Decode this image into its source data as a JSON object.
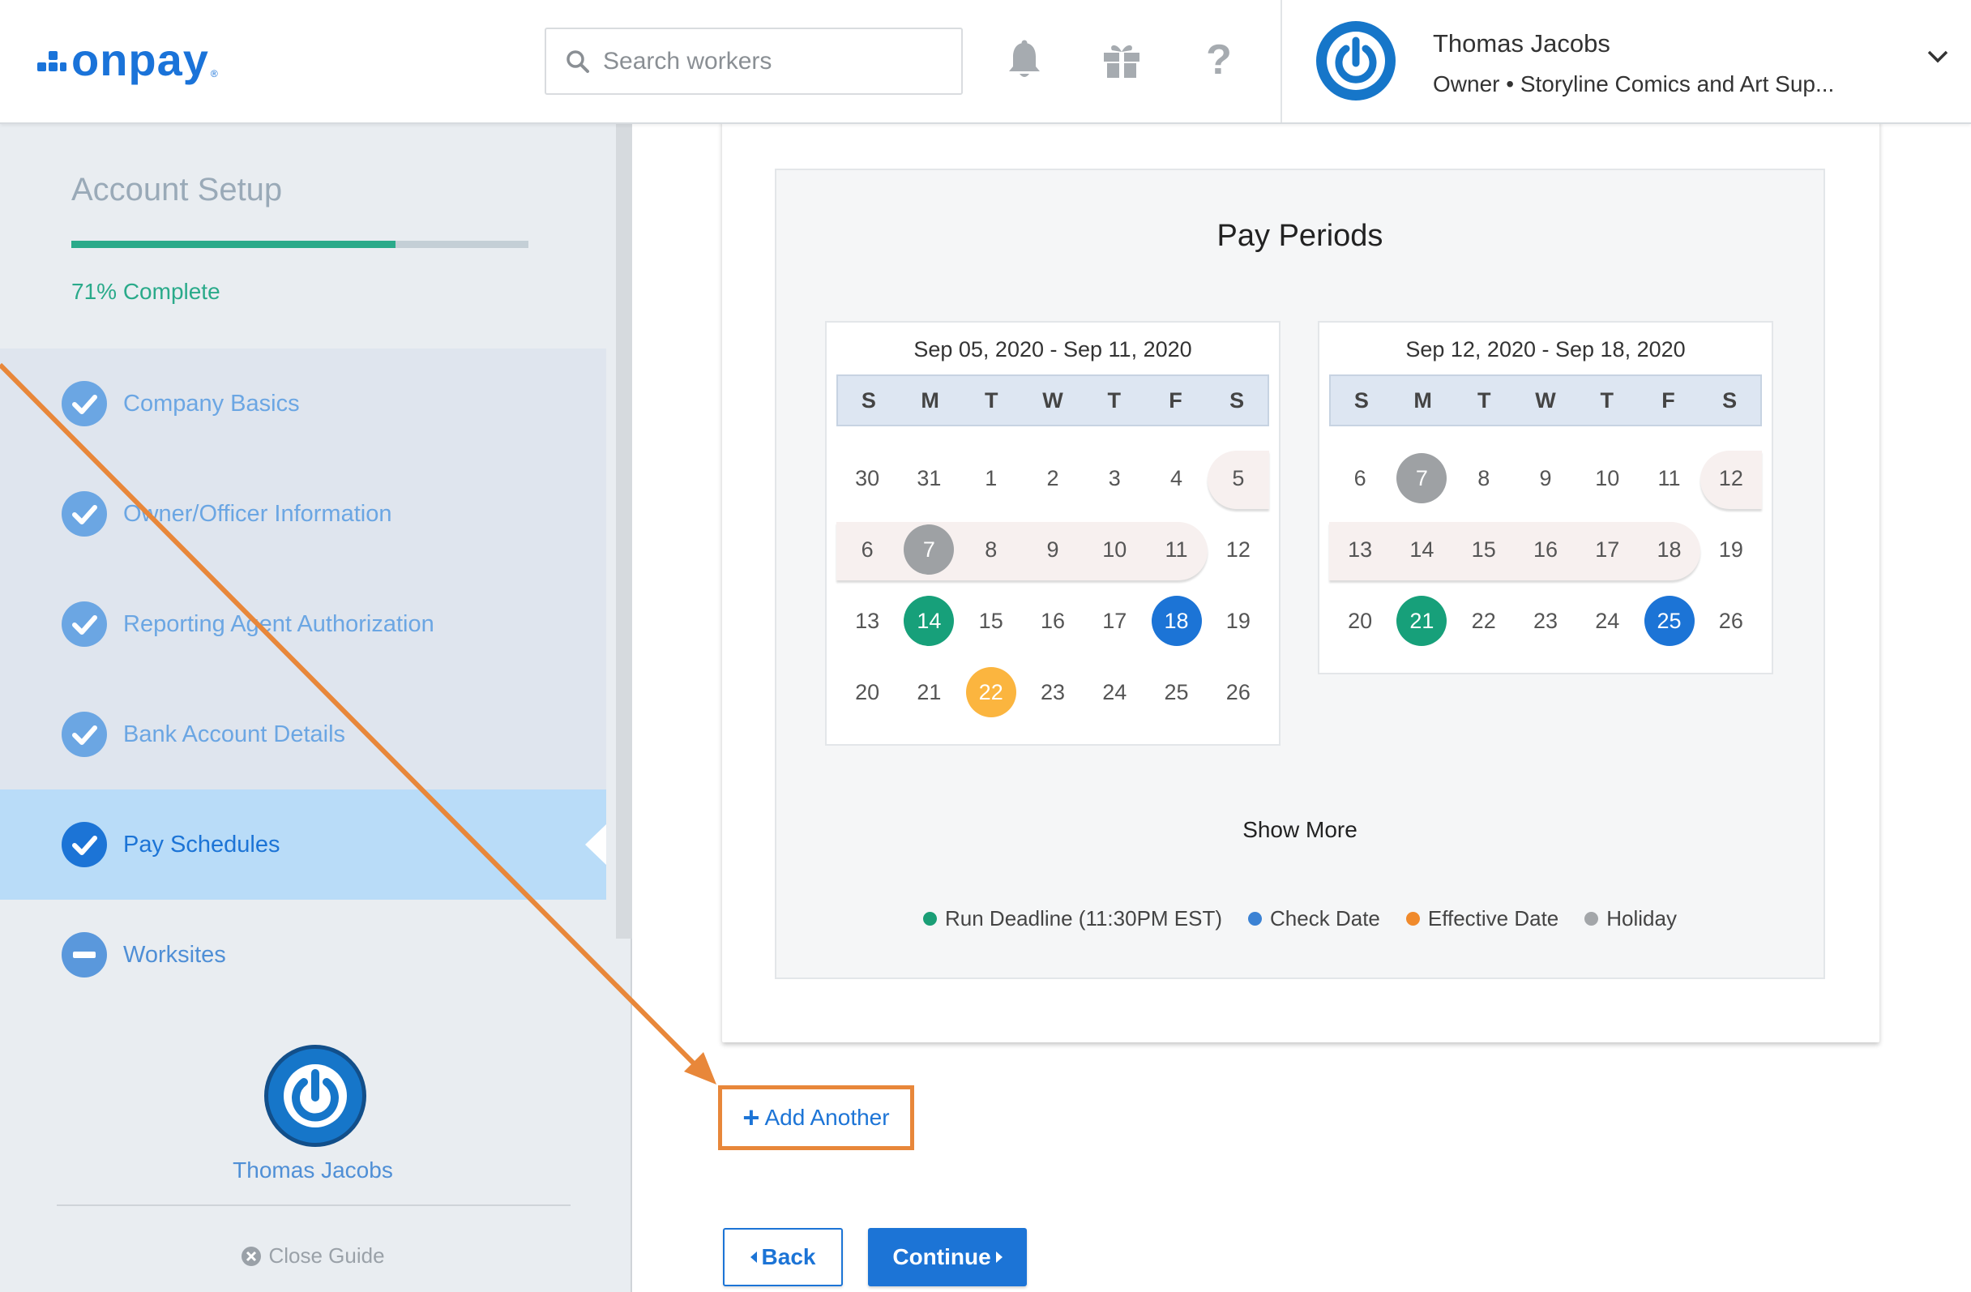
{
  "app": {
    "logo_text": "onpay",
    "logo_mark": "®"
  },
  "header": {
    "search_placeholder": "Search workers",
    "user_name": "Thomas Jacobs",
    "user_role": "Owner • Storyline Comics and Art Sup..."
  },
  "sidebar": {
    "title": "Account Setup",
    "progress_percent": 71,
    "progress_text": "71% Complete",
    "steps": [
      {
        "label": "Company Basics",
        "status": "complete"
      },
      {
        "label": "Owner/Officer Information",
        "status": "complete"
      },
      {
        "label": "Reporting Agent Authorization",
        "status": "complete"
      },
      {
        "label": "Bank Account Details",
        "status": "complete"
      },
      {
        "label": "Pay Schedules",
        "status": "active"
      },
      {
        "label": "Worksites",
        "status": "incomplete"
      }
    ],
    "guide_name": "Thomas Jacobs",
    "close_guide": "Close Guide"
  },
  "main": {
    "panel_title": "Pay Periods",
    "weekdays": [
      "S",
      "M",
      "T",
      "W",
      "T",
      "F",
      "S"
    ],
    "calendars": [
      {
        "range": "Sep 05, 2020 - Sep 11, 2020",
        "weeks": [
          [
            "30",
            "31",
            "1",
            "2",
            "3",
            "4",
            "5"
          ],
          [
            "6",
            "7",
            "8",
            "9",
            "10",
            "11",
            "12"
          ],
          [
            "13",
            "14",
            "15",
            "16",
            "17",
            "18",
            "19"
          ],
          [
            "20",
            "21",
            "22",
            "23",
            "24",
            "25",
            "26"
          ]
        ],
        "marks": {
          "0-6": "period",
          "1-1": "holiday",
          "2-1": "deadline",
          "2-5": "check",
          "3-2": "effective"
        },
        "period_bands": [
          {
            "row": 0,
            "from": 6,
            "to": 6,
            "open_right": true
          },
          {
            "row": 1,
            "from": 0,
            "to": 5,
            "open_left": true
          }
        ]
      },
      {
        "range": "Sep 12, 2020 - Sep 18, 2020",
        "weeks": [
          [
            "6",
            "7",
            "8",
            "9",
            "10",
            "11",
            "12"
          ],
          [
            "13",
            "14",
            "15",
            "16",
            "17",
            "18",
            "19"
          ],
          [
            "20",
            "21",
            "22",
            "23",
            "24",
            "25",
            "26"
          ]
        ],
        "marks": {
          "0-1": "holiday",
          "2-1": "deadline",
          "2-5": "check"
        },
        "period_bands": [
          {
            "row": 0,
            "from": 6,
            "to": 6,
            "open_right": true
          },
          {
            "row": 1,
            "from": 0,
            "to": 5,
            "open_left": true
          }
        ]
      }
    ],
    "show_more": "Show More",
    "legend": [
      {
        "key": "deadline",
        "label": "Run Deadline (11:30PM EST)",
        "color": "#1a9e76"
      },
      {
        "key": "check",
        "label": "Check Date",
        "color": "#3b82d4"
      },
      {
        "key": "effective",
        "label": "Effective Date",
        "color": "#f08a2c"
      },
      {
        "key": "holiday",
        "label": "Holiday",
        "color": "#a3a6a9"
      }
    ],
    "add_another": "Add Another",
    "back_label": "Back",
    "continue_label": "Continue"
  },
  "colors": {
    "accent": "#1c74d6",
    "deadline": "#17a07a",
    "check": "#1c74d6",
    "effective": "#fbb53f",
    "holiday": "#9ea1a4",
    "annotation": "#e8873a"
  }
}
